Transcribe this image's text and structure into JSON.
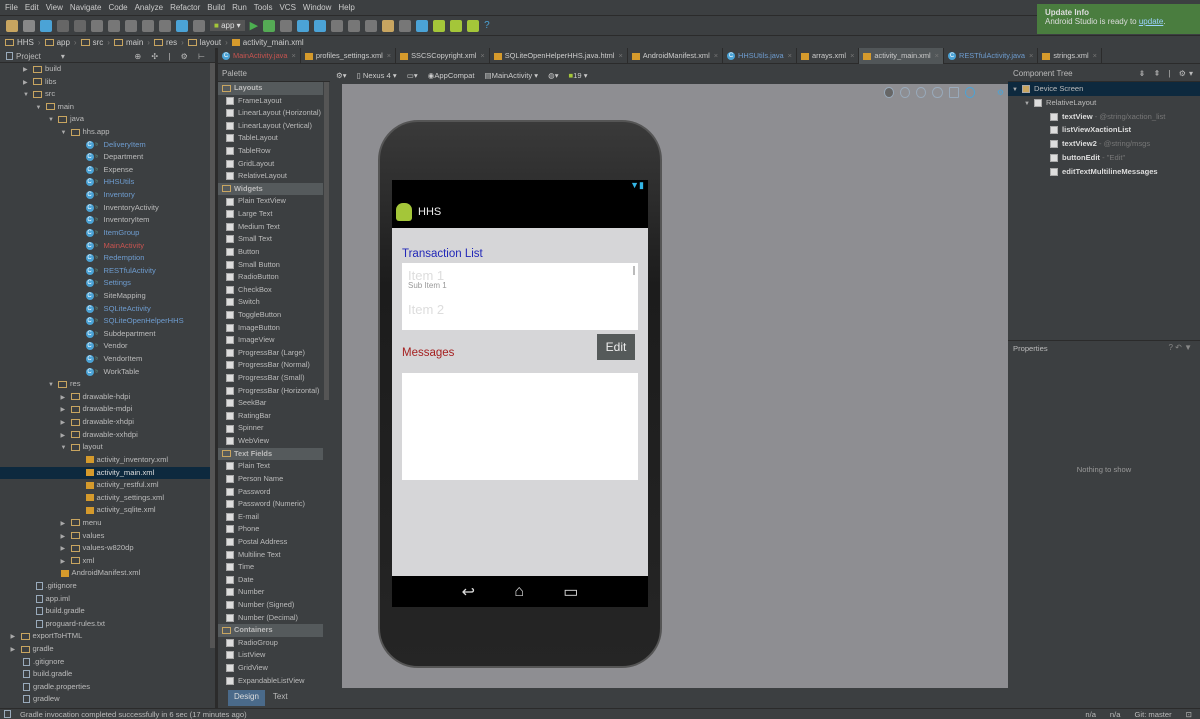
{
  "menu": [
    "File",
    "Edit",
    "View",
    "Navigate",
    "Code",
    "Analyze",
    "Refactor",
    "Build",
    "Run",
    "Tools",
    "VCS",
    "Window",
    "Help"
  ],
  "toolbar": {
    "run_config": "app"
  },
  "breadcrumb": [
    "HHS",
    "app",
    "src",
    "main",
    "res",
    "layout",
    "activity_main.xml"
  ],
  "notification": {
    "title": "Update Info",
    "text": "Android Studio is ready to ",
    "link": "update",
    "suffix": "."
  },
  "project": {
    "title": "Project",
    "tree": [
      {
        "l": "build",
        "d": 2,
        "t": "folder",
        "a": "r"
      },
      {
        "l": "libs",
        "d": 2,
        "t": "folder",
        "a": "r"
      },
      {
        "l": "src",
        "d": 2,
        "t": "folder",
        "a": "d"
      },
      {
        "l": "main",
        "d": 3,
        "t": "folder",
        "a": "d"
      },
      {
        "l": "java",
        "d": 4,
        "t": "folder",
        "a": "d"
      },
      {
        "l": "hhs.app",
        "d": 5,
        "t": "folder",
        "a": "d"
      },
      {
        "l": "DeliveryItem",
        "d": 7,
        "t": "class",
        "c": "#6e9ccf"
      },
      {
        "l": "Department",
        "d": 7,
        "t": "class"
      },
      {
        "l": "Expense",
        "d": 7,
        "t": "class"
      },
      {
        "l": "HHSUtils",
        "d": 7,
        "t": "class",
        "c": "#6e9ccf"
      },
      {
        "l": "Inventory",
        "d": 7,
        "t": "class",
        "c": "#6e9ccf"
      },
      {
        "l": "InventoryActivity",
        "d": 7,
        "t": "class"
      },
      {
        "l": "InventoryItem",
        "d": 7,
        "t": "class"
      },
      {
        "l": "ItemGroup",
        "d": 7,
        "t": "class",
        "c": "#6e9ccf"
      },
      {
        "l": "MainActivity",
        "d": 7,
        "t": "class",
        "c": "#c75450"
      },
      {
        "l": "Redemption",
        "d": 7,
        "t": "class",
        "c": "#6e9ccf"
      },
      {
        "l": "RESTfulActivity",
        "d": 7,
        "t": "class",
        "c": "#6e9ccf"
      },
      {
        "l": "Settings",
        "d": 7,
        "t": "class",
        "c": "#6e9ccf"
      },
      {
        "l": "SiteMapping",
        "d": 7,
        "t": "class"
      },
      {
        "l": "SQLiteActivity",
        "d": 7,
        "t": "class",
        "c": "#6e9ccf"
      },
      {
        "l": "SQLiteOpenHelperHHS",
        "d": 7,
        "t": "class",
        "c": "#6e9ccf"
      },
      {
        "l": "Subdepartment",
        "d": 7,
        "t": "class"
      },
      {
        "l": "Vendor",
        "d": 7,
        "t": "class"
      },
      {
        "l": "VendorItem",
        "d": 7,
        "t": "class"
      },
      {
        "l": "WorkTable",
        "d": 7,
        "t": "class"
      },
      {
        "l": "res",
        "d": 4,
        "t": "folder",
        "a": "d"
      },
      {
        "l": "drawable-hdpi",
        "d": 5,
        "t": "folder",
        "a": "r"
      },
      {
        "l": "drawable-mdpi",
        "d": 5,
        "t": "folder",
        "a": "r"
      },
      {
        "l": "drawable-xhdpi",
        "d": 5,
        "t": "folder",
        "a": "r"
      },
      {
        "l": "drawable-xxhdpi",
        "d": 5,
        "t": "folder",
        "a": "r"
      },
      {
        "l": "layout",
        "d": 5,
        "t": "folder",
        "a": "d"
      },
      {
        "l": "activity_inventory.xml",
        "d": 7,
        "t": "xml"
      },
      {
        "l": "activity_main.xml",
        "d": 7,
        "t": "xml",
        "s": true
      },
      {
        "l": "activity_restful.xml",
        "d": 7,
        "t": "xml"
      },
      {
        "l": "activity_settings.xml",
        "d": 7,
        "t": "xml"
      },
      {
        "l": "activity_sqlite.xml",
        "d": 7,
        "t": "xml"
      },
      {
        "l": "menu",
        "d": 5,
        "t": "folder",
        "a": "r"
      },
      {
        "l": "values",
        "d": 5,
        "t": "folder",
        "a": "r"
      },
      {
        "l": "values-w820dp",
        "d": 5,
        "t": "folder",
        "a": "r"
      },
      {
        "l": "xml",
        "d": 5,
        "t": "folder",
        "a": "r"
      },
      {
        "l": "AndroidManifest.xml",
        "d": 5,
        "t": "xml"
      },
      {
        "l": ".gitignore",
        "d": 3,
        "t": "file"
      },
      {
        "l": "app.iml",
        "d": 3,
        "t": "file"
      },
      {
        "l": "build.gradle",
        "d": 3,
        "t": "file"
      },
      {
        "l": "proguard-rules.txt",
        "d": 3,
        "t": "file"
      },
      {
        "l": "exportToHTML",
        "d": 1,
        "t": "folder",
        "a": "r"
      },
      {
        "l": "gradle",
        "d": 1,
        "t": "folder",
        "a": "r"
      },
      {
        "l": ".gitignore",
        "d": 2,
        "t": "file"
      },
      {
        "l": "build.gradle",
        "d": 2,
        "t": "file"
      },
      {
        "l": "gradle.properties",
        "d": 2,
        "t": "file"
      },
      {
        "l": "gradlew",
        "d": 2,
        "t": "file"
      }
    ]
  },
  "tabs": [
    {
      "l": "MainActivity.java",
      "c": "#c75450"
    },
    {
      "l": "profiles_settings.xml"
    },
    {
      "l": "SSCSCopyright.xml"
    },
    {
      "l": "SQLiteOpenHelperHHS.java.html"
    },
    {
      "l": "AndroidManifest.xml"
    },
    {
      "l": "HHSUtils.java",
      "c": "#6e9ccf"
    },
    {
      "l": "arrays.xml"
    },
    {
      "l": "activity_main.xml",
      "active": true
    },
    {
      "l": "RESTfulActivity.java",
      "c": "#6e9ccf"
    },
    {
      "l": "strings.xml"
    }
  ],
  "palette": {
    "title": "Palette",
    "rows": [
      {
        "h": "Layouts"
      },
      {
        "l": "FrameLayout"
      },
      {
        "l": "LinearLayout (Horizontal)"
      },
      {
        "l": "LinearLayout (Vertical)"
      },
      {
        "l": "TableLayout"
      },
      {
        "l": "TableRow"
      },
      {
        "l": "GridLayout"
      },
      {
        "l": "RelativeLayout"
      },
      {
        "h": "Widgets"
      },
      {
        "l": "Plain TextView"
      },
      {
        "l": "Large Text"
      },
      {
        "l": "Medium Text"
      },
      {
        "l": "Small Text"
      },
      {
        "l": "Button"
      },
      {
        "l": "Small Button"
      },
      {
        "l": "RadioButton"
      },
      {
        "l": "CheckBox"
      },
      {
        "l": "Switch"
      },
      {
        "l": "ToggleButton"
      },
      {
        "l": "ImageButton"
      },
      {
        "l": "ImageView"
      },
      {
        "l": "ProgressBar (Large)"
      },
      {
        "l": "ProgressBar (Normal)"
      },
      {
        "l": "ProgressBar (Small)"
      },
      {
        "l": "ProgressBar (Horizontal)"
      },
      {
        "l": "SeekBar"
      },
      {
        "l": "RatingBar"
      },
      {
        "l": "Spinner"
      },
      {
        "l": "WebView"
      },
      {
        "h": "Text Fields"
      },
      {
        "l": "Plain Text"
      },
      {
        "l": "Person Name"
      },
      {
        "l": "Password"
      },
      {
        "l": "Password (Numeric)"
      },
      {
        "l": "E-mail"
      },
      {
        "l": "Phone"
      },
      {
        "l": "Postal Address"
      },
      {
        "l": "Multiline Text"
      },
      {
        "l": "Time"
      },
      {
        "l": "Date"
      },
      {
        "l": "Number"
      },
      {
        "l": "Number (Signed)"
      },
      {
        "l": "Number (Decimal)"
      },
      {
        "h": "Containers"
      },
      {
        "l": "RadioGroup"
      },
      {
        "l": "ListView"
      },
      {
        "l": "GridView"
      },
      {
        "l": "ExpandableListView"
      }
    ]
  },
  "design_tabs": {
    "design": "Design",
    "text": "Text"
  },
  "canvas_toolbar": {
    "device": "Nexus 4",
    "theme": "AppCompat",
    "activity": "MainActivity",
    "api": "19"
  },
  "device": {
    "app_title": "HHS",
    "transaction_label": "Transaction List",
    "list_items": [
      "Item 1",
      "Sub Item 1",
      "Item 2"
    ],
    "edit_button": "Edit",
    "messages_label": "Messages"
  },
  "component_tree": {
    "title": "Component Tree",
    "rows": [
      {
        "n": "Device Screen",
        "d": 0,
        "sel": true
      },
      {
        "n": "RelativeLayout",
        "d": 1
      },
      {
        "n": "textView",
        "h": " - @string/xaction_list",
        "d": 2
      },
      {
        "n": "listViewXactionList",
        "h": "",
        "d": 2
      },
      {
        "n": "textView2",
        "h": " - @string/msgs",
        "d": 2
      },
      {
        "n": "buttonEdit",
        "h": " - \"Edit\"",
        "d": 2
      },
      {
        "n": "editTextMultilineMessages",
        "h": "",
        "d": 2
      }
    ]
  },
  "properties": {
    "title": "Properties",
    "empty": "Nothing to show"
  },
  "status": {
    "message": "Gradle invocation completed successfully in 6 sec (17 minutes ago)",
    "col1": "n/a",
    "col2": "n/a",
    "vcs": "Git: master"
  }
}
